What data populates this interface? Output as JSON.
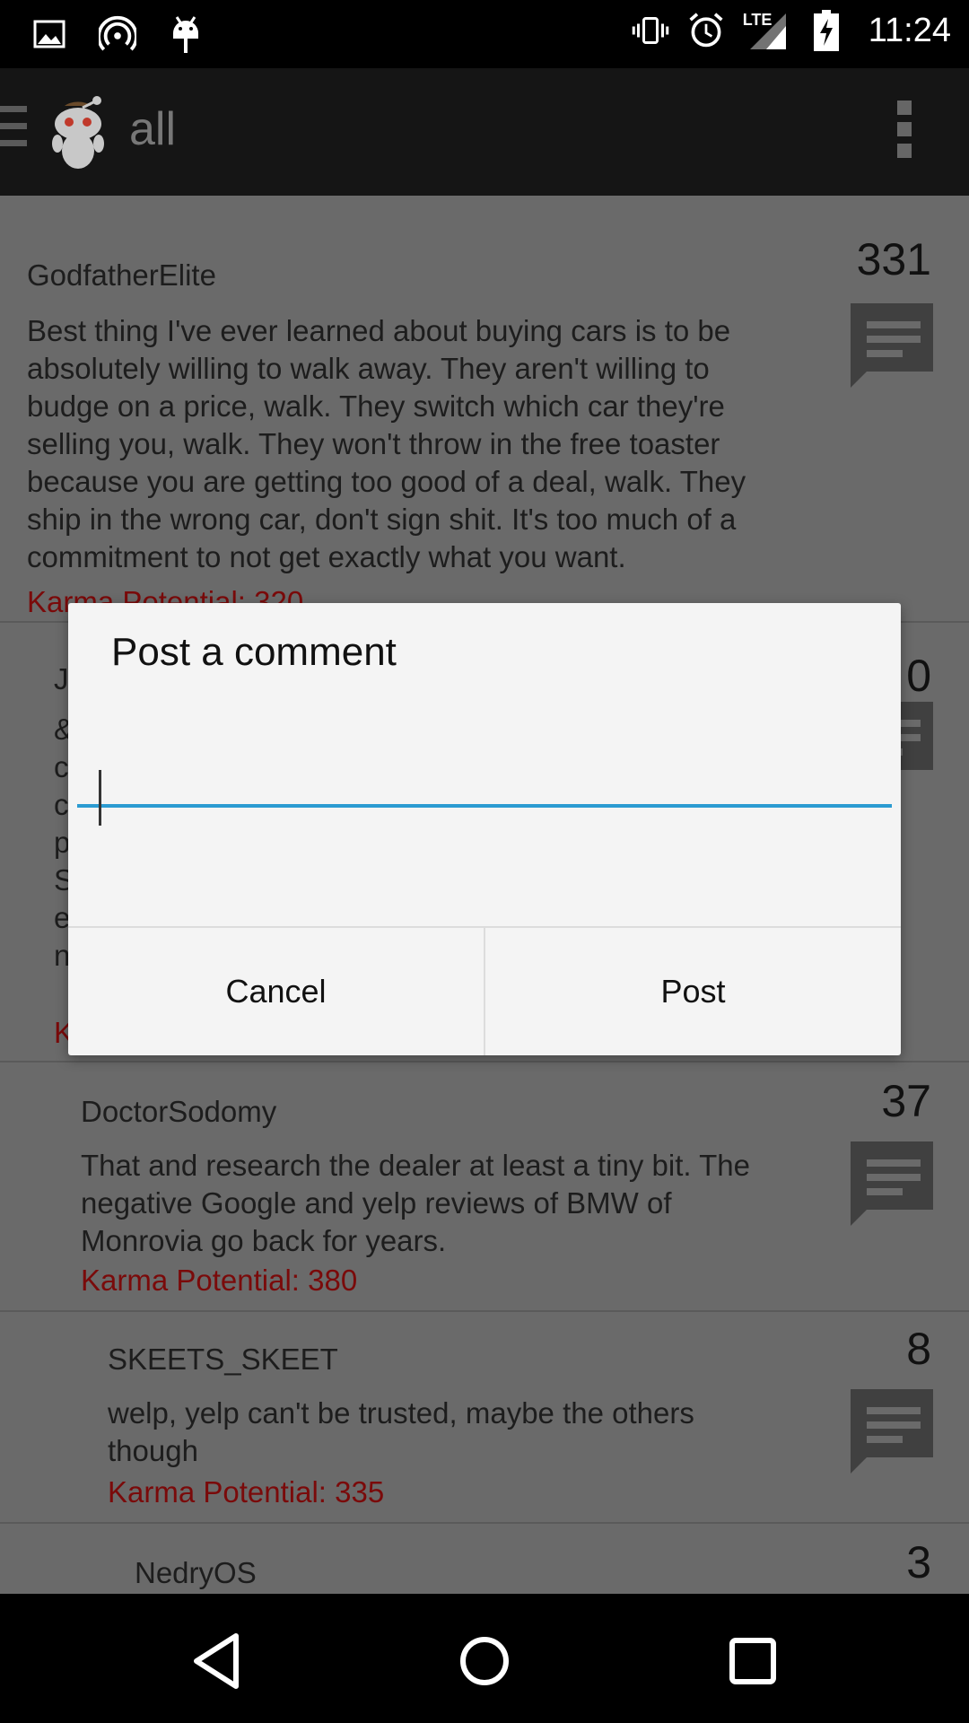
{
  "status_bar": {
    "icons_left": [
      "image-icon",
      "hotspot-icon",
      "android-debug-icon"
    ],
    "icons_right": [
      "vibrate-icon",
      "alarm-icon",
      "lte-signal-icon",
      "battery-charging-icon"
    ],
    "lte_label": "LTE",
    "time": "11:24"
  },
  "app_bar": {
    "title": "all",
    "icons": [
      "menu-icon",
      "reddit-alien-icon",
      "overflow-menu-icon"
    ]
  },
  "comments": [
    {
      "author": "GodfatherElite",
      "body": [
        "Best thing I've ever learned about buying cars is to be",
        "absolutely willing to walk away. They aren't willing to",
        "budge on a price, walk. They switch which car they're",
        "selling you, walk. They won't throw in the free toaster",
        "because you are getting too good of a deal, walk. They",
        "ship in the wrong car, don't sign shit. It's too much of a",
        "commitment to not get exactly what you want."
      ],
      "karma": "Karma Potential: 320",
      "score": "331"
    },
    {
      "author": "J",
      "body": [
        "&",
        "c",
        "c",
        "p",
        "",
        "S",
        "e",
        "n"
      ],
      "karma": "K",
      "score": "0"
    },
    {
      "author": "DoctorSodomy",
      "body": [
        "That and research the dealer at least a tiny bit.  The",
        "negative Google and yelp reviews of BMW of",
        "Monrovia go back for years."
      ],
      "karma": "Karma Potential: 380",
      "score": "37"
    },
    {
      "author": "SKEETS_SKEET",
      "body": [
        "welp, yelp can't be trusted, maybe the others",
        "though"
      ],
      "karma": "Karma Potential: 335",
      "score": "8"
    },
    {
      "author": "NedryOS",
      "body": [],
      "karma": "",
      "score": "3"
    }
  ],
  "dialog": {
    "title": "Post a comment",
    "input_value": "",
    "cancel_label": "Cancel",
    "post_label": "Post"
  },
  "nav_bar": {
    "icons": [
      "back-icon",
      "home-icon",
      "recents-icon"
    ]
  },
  "colors": {
    "accent": "#2b9bd1",
    "karma": "#7a0a0a",
    "content_bg": "#6a6a6a"
  }
}
